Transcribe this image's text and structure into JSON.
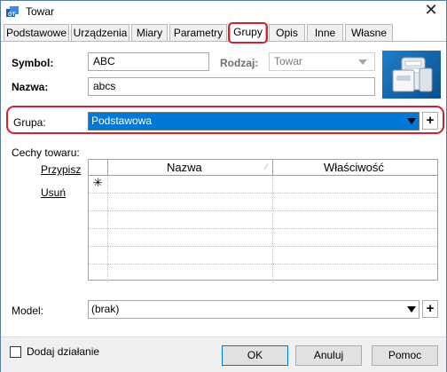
{
  "window": {
    "title": "Towar",
    "close_glyph": "✕"
  },
  "tabs": [
    {
      "label": "Podstawowe"
    },
    {
      "label": "Urządzenia"
    },
    {
      "label": "Miary"
    },
    {
      "label": "Parametry"
    },
    {
      "label": "Grupy",
      "active": true
    },
    {
      "label": "Opis"
    },
    {
      "label": "Inne"
    },
    {
      "label": "Własne"
    }
  ],
  "form": {
    "symbol_label": "Symbol:",
    "symbol_value": "ABC",
    "rodzaj_label": "Rodzaj:",
    "rodzaj_value": "Towar",
    "nazwa_label": "Nazwa:",
    "nazwa_value": "abcs",
    "grupa_label": "Grupa:",
    "grupa_value": "Podstawowa",
    "cechy_label": "Cechy towaru:",
    "przypisz_link": "Przypisz",
    "usun_link": "Usuń",
    "grid_headers": [
      "Nazwa",
      "Właściwość"
    ],
    "new_row_glyph": "✳",
    "model_label": "Model:",
    "model_value": "(brak)"
  },
  "footer": {
    "add_action_label": "Dodaj działanie",
    "ok_label": "OK",
    "cancel_label": "Anuluj",
    "help_label": "Pomoc"
  },
  "colors": {
    "accent": "#0078d7",
    "highlight": "#d6202b"
  }
}
